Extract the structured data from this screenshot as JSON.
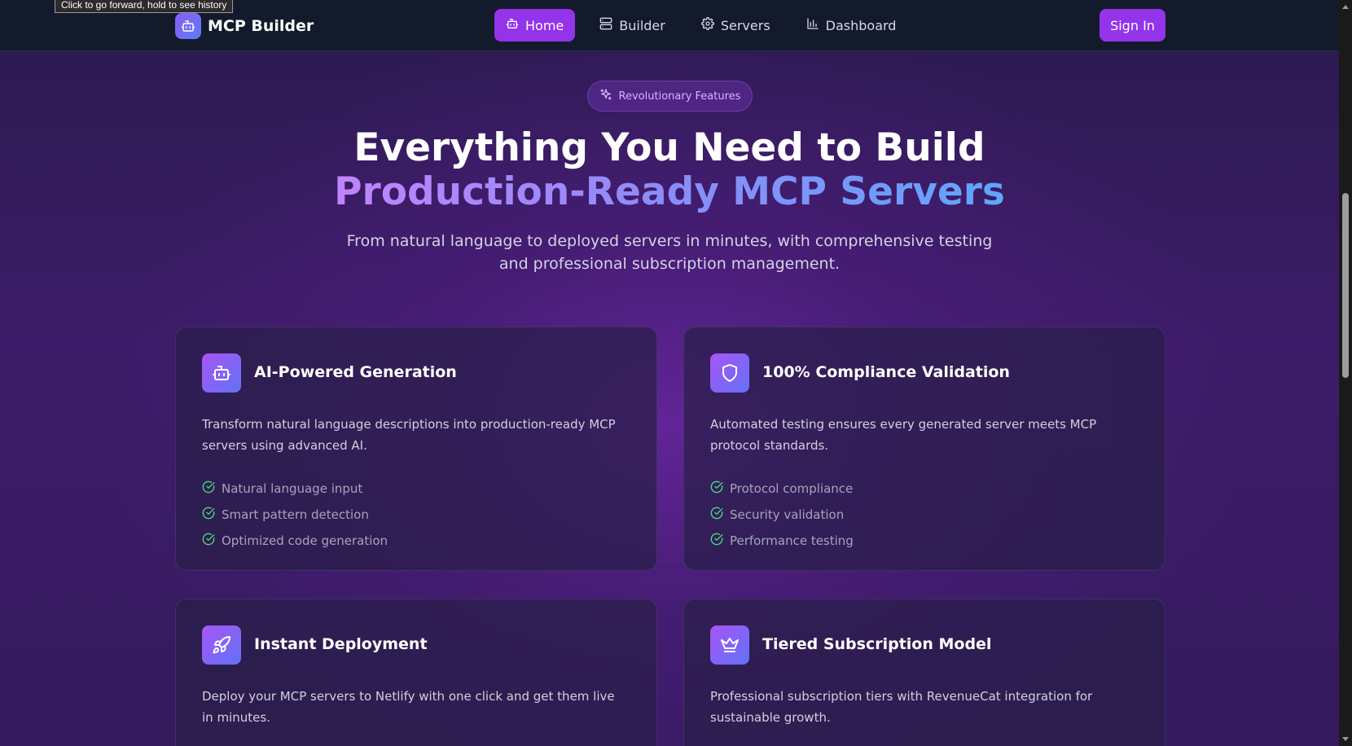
{
  "tooltip": "Click to go forward, hold to see history",
  "brand": {
    "name": "MCP Builder",
    "icon": "robot-icon"
  },
  "nav": {
    "items": [
      {
        "label": "Home",
        "icon": "robot-icon",
        "active": true
      },
      {
        "label": "Builder",
        "icon": "server-icon",
        "active": false
      },
      {
        "label": "Servers",
        "icon": "gear-icon",
        "active": false
      },
      {
        "label": "Dashboard",
        "icon": "bar-chart-icon",
        "active": false
      }
    ],
    "sign_in_label": "Sign In"
  },
  "hero": {
    "badge": "Revolutionary Features",
    "title_line1": "Everything You Need to Build",
    "title_line2": "Production-Ready MCP Servers",
    "subtitle": "From natural language to deployed servers in minutes, with comprehensive testing and professional subscription management."
  },
  "cards": [
    {
      "icon": "robot-icon",
      "title": "AI-Powered Generation",
      "description": "Transform natural language descriptions into production-ready MCP servers using advanced AI.",
      "features": [
        "Natural language input",
        "Smart pattern detection",
        "Optimized code generation"
      ]
    },
    {
      "icon": "shield-icon",
      "title": "100% Compliance Validation",
      "description": "Automated testing ensures every generated server meets MCP protocol standards.",
      "features": [
        "Protocol compliance",
        "Security validation",
        "Performance testing"
      ]
    },
    {
      "icon": "rocket-icon",
      "title": "Instant Deployment",
      "description": "Deploy your MCP servers to Netlify with one click and get them live in minutes.",
      "features": []
    },
    {
      "icon": "crown-icon",
      "title": "Tiered Subscription Model",
      "description": "Professional subscription tiers with RevenueCat integration for sustainable growth.",
      "features": []
    }
  ],
  "colors": {
    "accent": "#9333ea",
    "navbar_bg": "#131a2b",
    "check_green": "#4ade80",
    "gradient_start": "#c084fc",
    "gradient_end": "#60a5fa"
  }
}
